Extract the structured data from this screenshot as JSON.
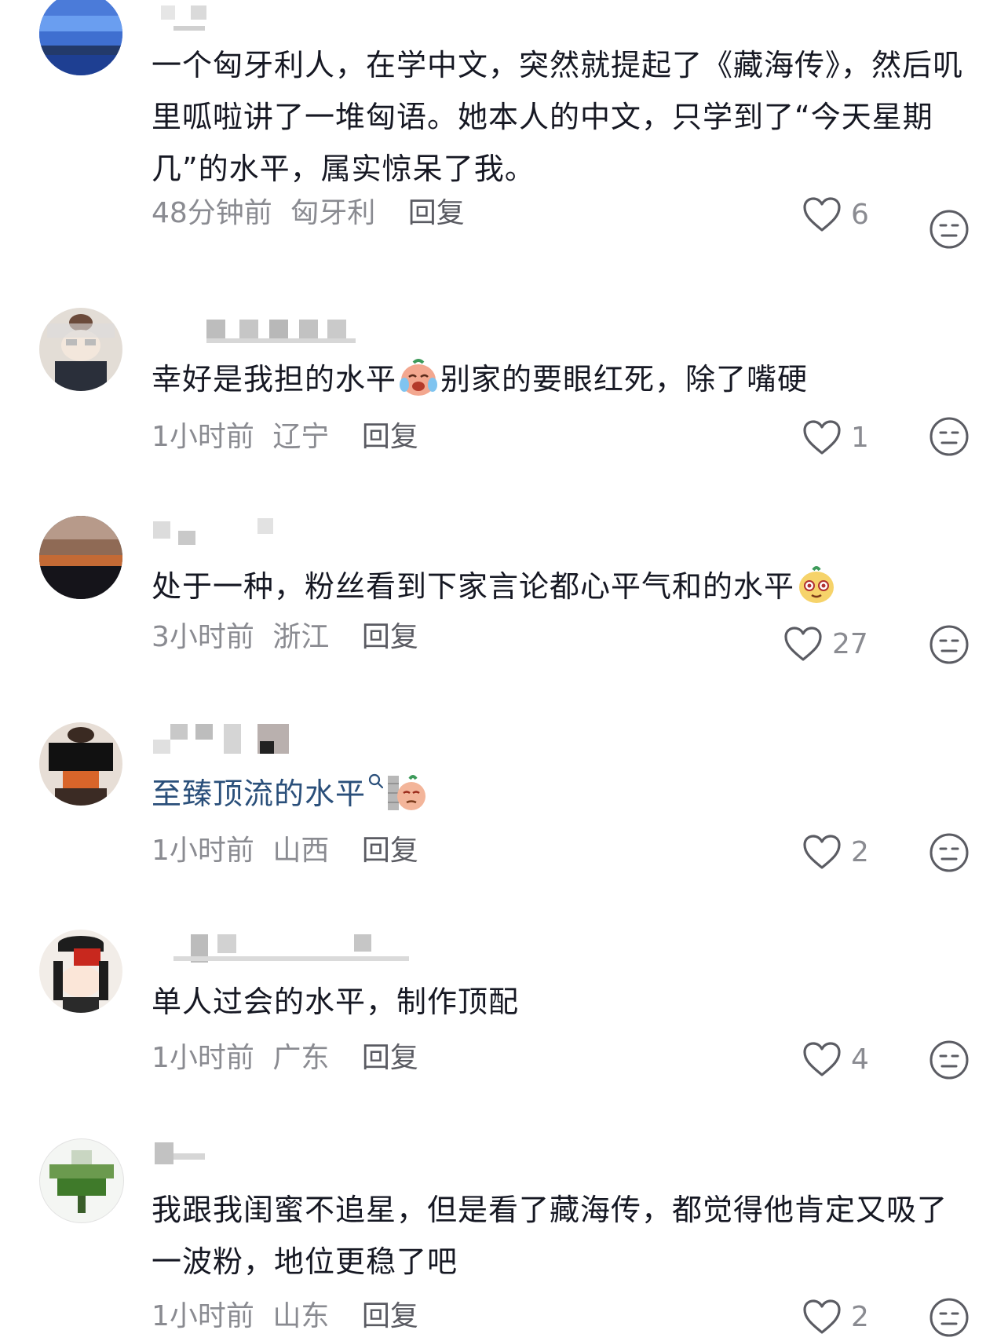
{
  "comments": [
    {
      "text": "一个匈牙利人，在学中文，突然就提起了《藏海传》，然后叽里呱啦讲了一堆匈语。她本人的中文，只学到了“今天星期几”的水平，属实惊呆了我。",
      "time": "48分钟前",
      "location": "匈牙利",
      "reply": "回复",
      "likes": "6"
    },
    {
      "text_before": "幸好是我担的水平",
      "emoji": "crying-laughing-emoji",
      "text_after": "别家的要眼红死，除了嘴硬",
      "time": "1小时前",
      "location": "辽宁",
      "reply": "回复",
      "likes": "1"
    },
    {
      "text": "处于一种，粉丝看到下家言论都心平气和的水平",
      "emoji": "smug-face-emoji",
      "time": "3小时前",
      "location": "浙江",
      "reply": "回复",
      "likes": "27"
    },
    {
      "link_text": "至臻顶流的水平",
      "emoji": "peeking-wall-emoji",
      "time": "1小时前",
      "location": "山西",
      "reply": "回复",
      "likes": "2"
    },
    {
      "text": "单人过会的水平，制作顶配",
      "time": "1小时前",
      "location": "广东",
      "reply": "回复",
      "likes": "4"
    },
    {
      "text": "我跟我闺蜜不追星，但是看了藏海传，都觉得他肯定又吸了一波粉，地位更稳了吧",
      "time": "1小时前",
      "location": "山东",
      "reply": "回复",
      "likes": "2"
    }
  ],
  "colors": {
    "text": "#161823",
    "meta": "#8a8b91",
    "link": "#2a4f7a",
    "icon_stroke": "#5b5c63"
  },
  "icons": {
    "like": "heart-outline-icon",
    "dislike": "neutral-face-icon",
    "search": "search-icon"
  }
}
